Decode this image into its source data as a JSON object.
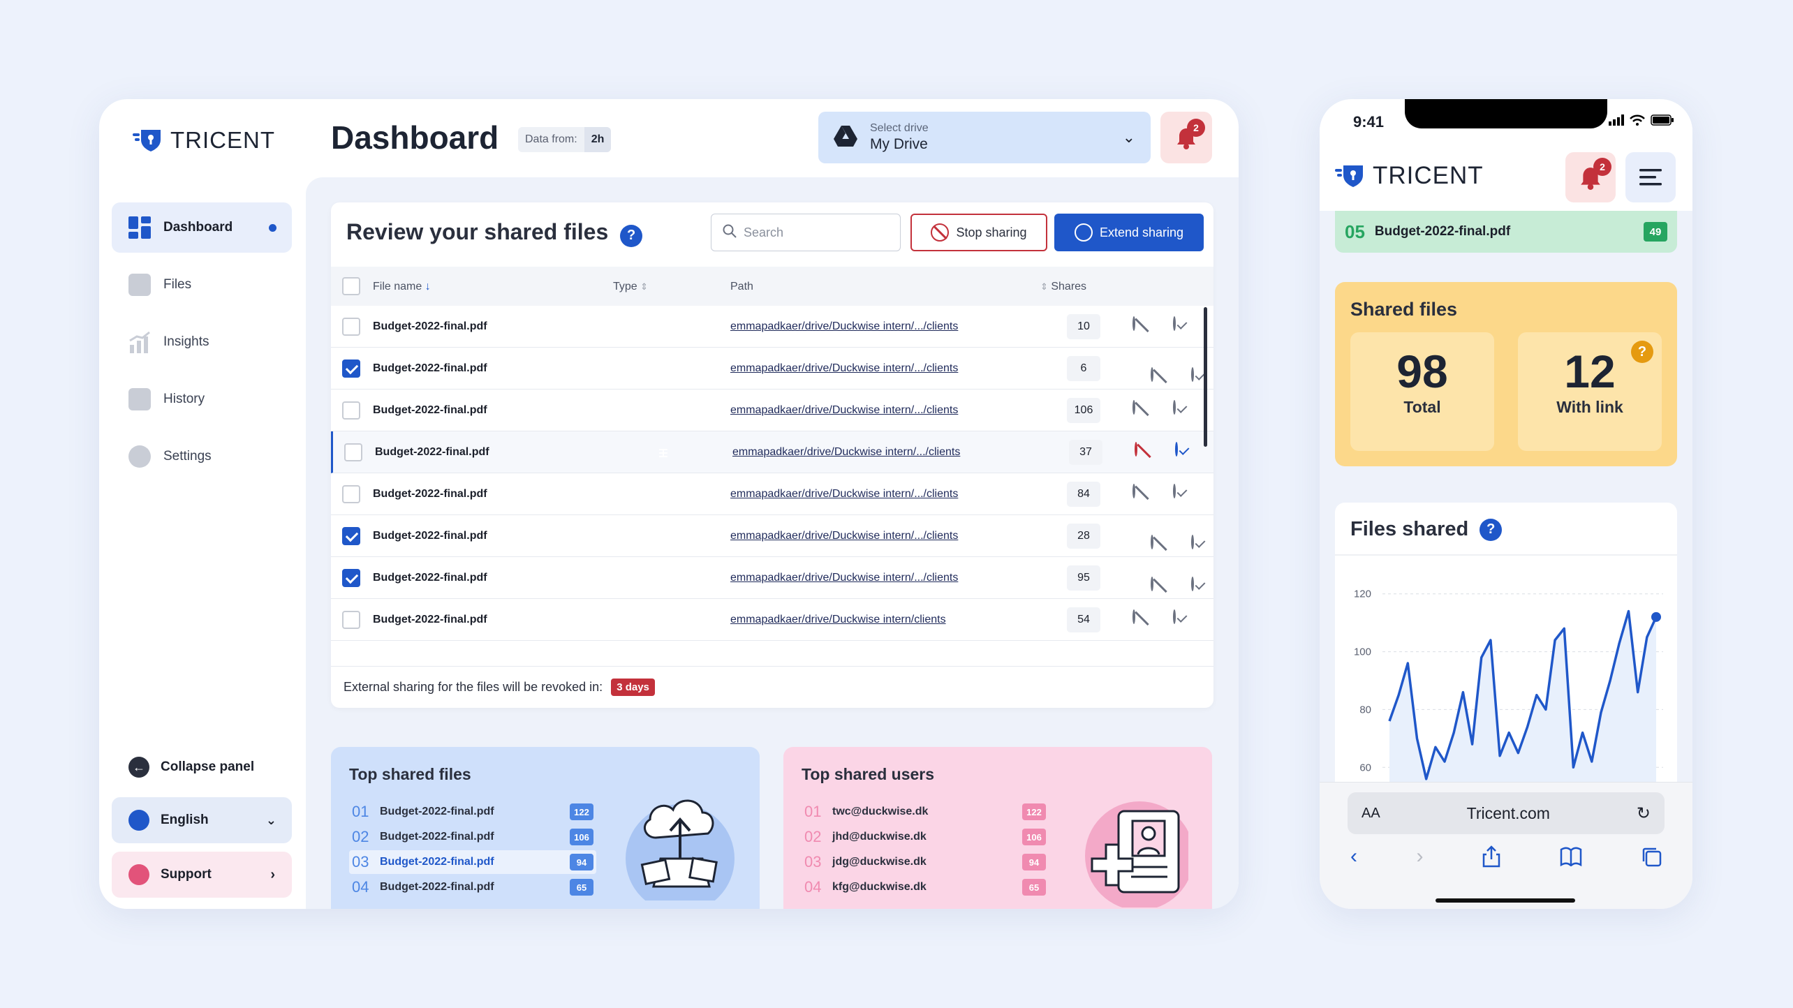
{
  "brand": {
    "name": "TRICENT"
  },
  "sidebar": {
    "items": [
      {
        "label": "Dashboard",
        "active": true
      },
      {
        "label": "Files"
      },
      {
        "label": "Insights"
      },
      {
        "label": "History"
      },
      {
        "label": "Settings"
      }
    ],
    "collapse_label": "Collapse panel",
    "language_label": "English",
    "support_label": "Support"
  },
  "header": {
    "title": "Dashboard",
    "data_from_label": "Data from:",
    "data_from_value": "2h",
    "drive_small": "Select drive",
    "drive_value": "My Drive",
    "notification_count": "2"
  },
  "review": {
    "title": "Review your shared files",
    "help": "?",
    "search_placeholder": "Search",
    "stop_label": "Stop sharing",
    "extend_label": "Extend sharing",
    "columns": {
      "name": "File name",
      "type": "Type",
      "path": "Path",
      "shares": "Shares"
    },
    "rows": [
      {
        "name": "Budget-2022-final.pdf",
        "path": "emmapadkaer/drive/Duckwise intern/.../clients",
        "shares": "10",
        "checked": false
      },
      {
        "name": "Budget-2022-final.pdf",
        "path": "emmapadkaer/drive/Duckwise intern/.../clients",
        "shares": "6",
        "checked": true
      },
      {
        "name": "Budget-2022-final.pdf",
        "path": "emmapadkaer/drive/Duckwise intern/.../clients",
        "shares": "106",
        "checked": false
      },
      {
        "name": "Budget-2022-final.pdf",
        "path": "emmapadkaer/drive/Duckwise intern/.../clients",
        "shares": "37",
        "checked": false,
        "highlight": true
      },
      {
        "name": "Budget-2022-final.pdf",
        "path": "emmapadkaer/drive/Duckwise intern/.../clients",
        "shares": "84",
        "checked": false
      },
      {
        "name": "Budget-2022-final.pdf",
        "path": "emmapadkaer/drive/Duckwise intern/.../clients",
        "shares": "28",
        "checked": true
      },
      {
        "name": "Budget-2022-final.pdf",
        "path": "emmapadkaer/drive/Duckwise intern/.../clients",
        "shares": "95",
        "checked": true
      },
      {
        "name": "Budget-2022-final.pdf",
        "path": "emmapadkaer/drive/Duckwise intern/clients",
        "shares": "54",
        "checked": false
      }
    ],
    "footer_text": "External sharing for the files will be revoked in:",
    "footer_days": "3 days"
  },
  "top_files": {
    "title": "Top shared files",
    "items": [
      {
        "num": "01",
        "name": "Budget-2022-final.pdf",
        "count": "122"
      },
      {
        "num": "02",
        "name": "Budget-2022-final.pdf",
        "count": "106"
      },
      {
        "num": "03",
        "name": "Budget-2022-final.pdf",
        "count": "94"
      },
      {
        "num": "04",
        "name": "Budget-2022-final.pdf",
        "count": "65"
      }
    ]
  },
  "top_users": {
    "title": "Top shared users",
    "items": [
      {
        "num": "01",
        "name": "twc@duckwise.dk",
        "count": "122"
      },
      {
        "num": "02",
        "name": "jhd@duckwise.dk",
        "count": "106"
      },
      {
        "num": "03",
        "name": "jdg@duckwise.dk",
        "count": "94"
      },
      {
        "num": "04",
        "name": "kfg@duckwise.dk",
        "count": "65"
      }
    ]
  },
  "mobile": {
    "time": "9:41",
    "notification_count": "2",
    "top_item": {
      "num": "05",
      "name": "Budget-2022-final.pdf",
      "count": "49"
    },
    "shared": {
      "title": "Shared files",
      "total_value": "98",
      "total_label": "Total",
      "link_value": "12",
      "link_label": "With link",
      "help": "?"
    },
    "files_shared_title": "Files shared",
    "help": "?",
    "url_aa": "AA",
    "url": "Tricent.com"
  },
  "chart_data": {
    "type": "line",
    "title": "Files shared",
    "y_ticks": [
      "120",
      "100",
      "80",
      "60"
    ],
    "ylim": [
      55,
      125
    ],
    "values": [
      76,
      85,
      96,
      70,
      56,
      67,
      62,
      72,
      86,
      68,
      98,
      104,
      64,
      72,
      65,
      74,
      85,
      80,
      104,
      108,
      60,
      72,
      62,
      79,
      90,
      103,
      114,
      86,
      105,
      112
    ]
  }
}
